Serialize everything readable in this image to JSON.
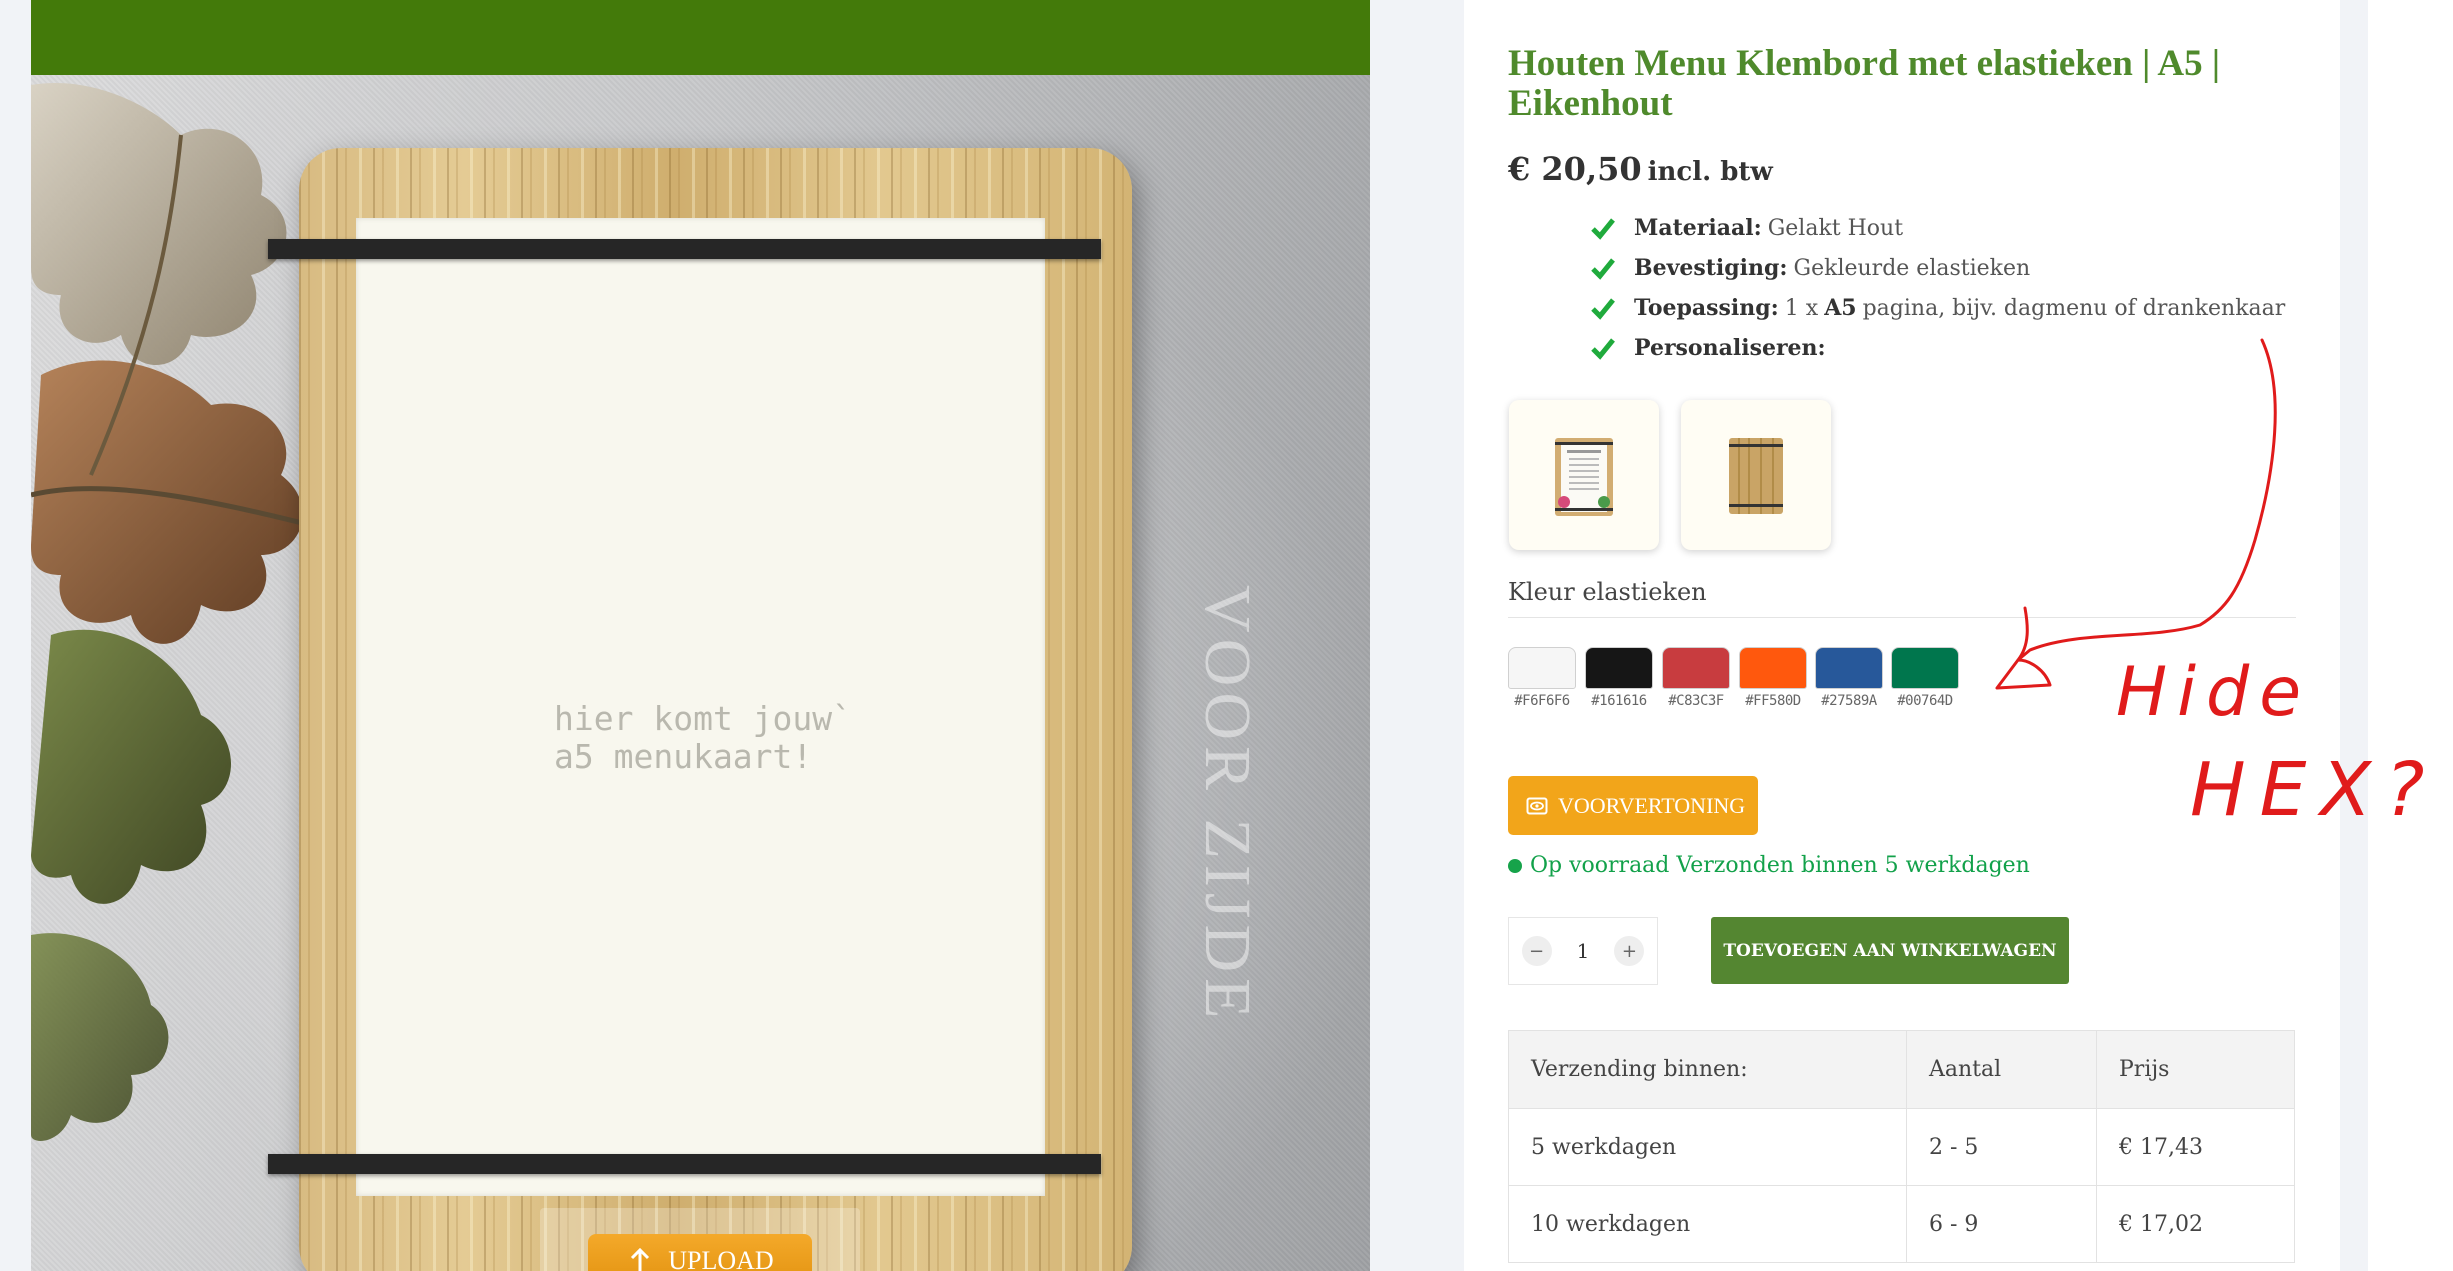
{
  "viewer": {
    "placeholder_text": "hier komt jouw`\na5 menukaart!",
    "side_label": "VOOR ZIJDE",
    "upload_label": "UPLOAD"
  },
  "product": {
    "title": "Houten Menu Klembord met elastieken | A5 | Eikenhout",
    "price": "€ 20,50",
    "price_suffix": "incl. btw",
    "features": [
      {
        "key": "Materiaal:",
        "value": "Gelakt Hout"
      },
      {
        "key": "Bevestiging:",
        "value": "Gekleurde elastieken"
      },
      {
        "key": "Toepassing:",
        "pre": "1 x",
        "bold": "A5",
        "value": "pagina, bijv. dagmenu of drankenkaar"
      },
      {
        "key": "Personaliseren:",
        "value": ""
      }
    ],
    "color_label": "Kleur elastieken",
    "swatches": [
      {
        "hex": "#F6F6F6"
      },
      {
        "hex": "#161616"
      },
      {
        "hex": "#C83C3F"
      },
      {
        "hex": "#FF580D"
      },
      {
        "hex": "#27589A"
      },
      {
        "hex": "#00764D"
      }
    ],
    "preview_label": "VOORVERTONING",
    "stock_text": "Op voorraad Verzonden binnen 5 werkdagen",
    "quantity": "1",
    "qty_minus": "−",
    "qty_plus": "+",
    "add_to_cart_label": "TOEVOEGEN AAN WINKELWAGEN"
  },
  "shipping_table": {
    "headers": [
      "Verzending binnen:",
      "Aantal",
      "Prijs"
    ],
    "rows": [
      [
        "5 werkdagen",
        "2 - 5",
        "€ 17,43"
      ],
      [
        "10 werkdagen",
        "6 - 9",
        "€ 17,02"
      ]
    ]
  },
  "annotation": {
    "text_line1": "Hide",
    "text_line2": "HEX?",
    "color": "#e01b1b"
  },
  "colors": {
    "brand_green": "#437a0a",
    "title_green": "#4f8a2c",
    "cart_green": "#548631",
    "stock_green": "#12a14a",
    "accent_orange": "#f2a51a"
  }
}
